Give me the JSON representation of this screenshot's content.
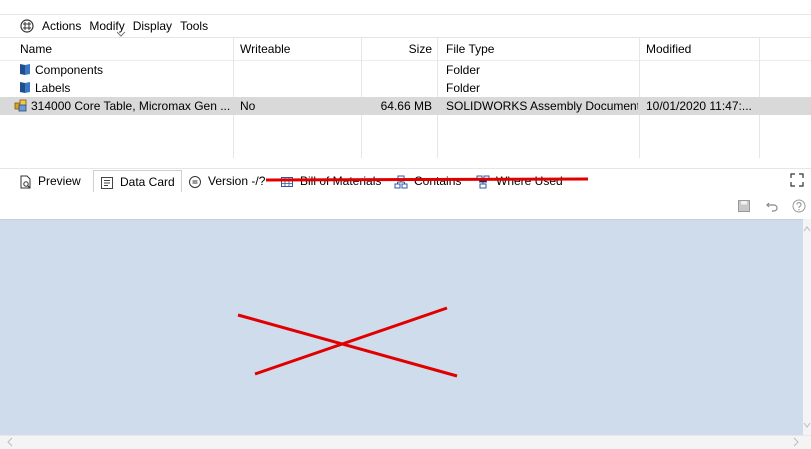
{
  "menu": {
    "items": [
      "Actions",
      "Modify",
      "Display",
      "Tools"
    ]
  },
  "grid": {
    "headers": {
      "name": "Name",
      "writeable": "Writeable",
      "size": "Size",
      "file_type": "File Type",
      "modified": "Modified"
    },
    "rows": [
      {
        "name": "Components",
        "writeable": "",
        "size": "",
        "file_type": "Folder",
        "modified": "",
        "icon": "folder-icon"
      },
      {
        "name": "Labels",
        "writeable": "",
        "size": "",
        "file_type": "Folder",
        "modified": "",
        "icon": "folder-icon"
      },
      {
        "name": "314000 Core Table, Micromax Gen ...",
        "writeable": "No",
        "size": "64.66 MB",
        "file_type": "SOLIDWORKS Assembly Document",
        "modified": "10/01/2020 11:47:...",
        "icon": "assembly-icon",
        "selected": true
      }
    ]
  },
  "tabs": {
    "preview": "Preview",
    "data_card": "Data Card",
    "version": "Version -/?",
    "bom": "Bill of Materials",
    "contains": "Contains",
    "where_used": "Where Used"
  },
  "colors": {
    "panel_bg": "#cfdcec",
    "annotation_red": "#e00000",
    "selected_row": "#d9d9d9"
  }
}
